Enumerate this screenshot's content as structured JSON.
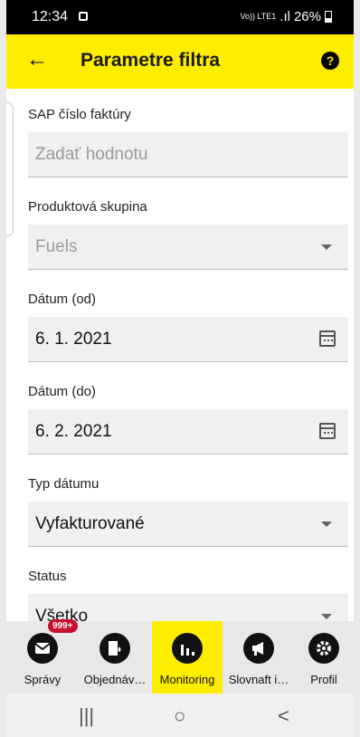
{
  "status_bar": {
    "time": "12:34",
    "network": "Vo)) LTE1",
    "battery": "26%"
  },
  "app_bar": {
    "title": "Parametre filtra",
    "back_icon": "arrow-left-icon",
    "help_icon": "question-icon"
  },
  "form": {
    "sap": {
      "label": "SAP číslo faktúry",
      "placeholder": "Zadať hodnotu",
      "value": ""
    },
    "product_group": {
      "label": "Produktová skupina",
      "value": "Fuels"
    },
    "date_from": {
      "label": "Dátum (od)",
      "value": "6. 1. 2021"
    },
    "date_to": {
      "label": "Dátum (do)",
      "value": "6. 2. 2021"
    },
    "date_type": {
      "label": "Typ dátumu",
      "value": "Vyfakturované"
    },
    "status": {
      "label": "Status",
      "value": "Všetko"
    }
  },
  "bottom_nav": {
    "items": [
      {
        "label": "Správy",
        "icon": "mail-icon",
        "badge": "999+"
      },
      {
        "label": "Objednáv…",
        "icon": "fuel-drop-icon"
      },
      {
        "label": "Monitoring",
        "icon": "bar-chart-icon",
        "active": true
      },
      {
        "label": "Slovnaft i…",
        "icon": "megaphone-icon"
      },
      {
        "label": "Profil",
        "icon": "gear-icon"
      }
    ]
  },
  "system_nav": {
    "recent": "|||",
    "home": "○",
    "back": "<"
  },
  "colors": {
    "accent": "#ffed00",
    "badge": "#c8102e"
  }
}
